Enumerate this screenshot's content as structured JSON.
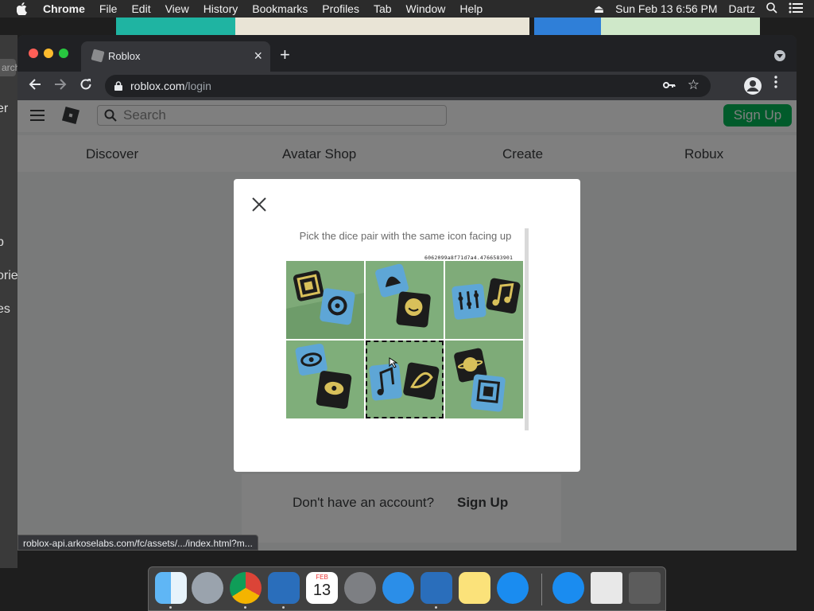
{
  "menubar": {
    "app": "Chrome",
    "items": [
      "File",
      "Edit",
      "View",
      "History",
      "Bookmarks",
      "Profiles",
      "Tab",
      "Window",
      "Help"
    ],
    "datetime": "Sun Feb 13  6:56 PM",
    "user": "Dartz"
  },
  "left_window": {
    "search": "arch",
    "fragments": [
      "er",
      "p",
      "orie",
      "es"
    ]
  },
  "browser": {
    "tab_title": "Roblox",
    "url_host": "roblox.com",
    "url_path": "/login",
    "status_url": "roblox-api.arkoselabs.com/fc/assets/.../index.html?m..."
  },
  "roblox": {
    "search_placeholder": "Search",
    "signup_button": "Sign Up",
    "nav": [
      "Discover",
      "Avatar Shop",
      "Create",
      "Robux"
    ],
    "no_account_text": "Don't have an account?",
    "signup_link": "Sign Up",
    "accent_color": "#02b757"
  },
  "captcha": {
    "instruction": "Pick the dice pair with the same icon facing up",
    "session_id": "6062099a8f71d7a4.4766583901",
    "tiles": [
      {
        "icons": [
          "crate",
          "ring"
        ],
        "selected": false
      },
      {
        "icons": [
          "helmet",
          "smile"
        ],
        "selected": false
      },
      {
        "icons": [
          "sliders",
          "note"
        ],
        "selected": false
      },
      {
        "icons": [
          "eye",
          "eye"
        ],
        "selected": false
      },
      {
        "icons": [
          "note",
          "leaf"
        ],
        "selected": true
      },
      {
        "icons": [
          "planet",
          "crate"
        ],
        "selected": false
      }
    ]
  },
  "dock": {
    "apps": [
      "Finder",
      "Launchpad",
      "Google Chrome",
      "VirtualBox",
      "Calendar",
      "System Preferences",
      "Safari",
      "VirtualBox VM",
      "Notes",
      "App Store",
      "Downloads",
      "Documents",
      "Trash"
    ],
    "calendar_month": "FEB",
    "calendar_day": "13"
  }
}
